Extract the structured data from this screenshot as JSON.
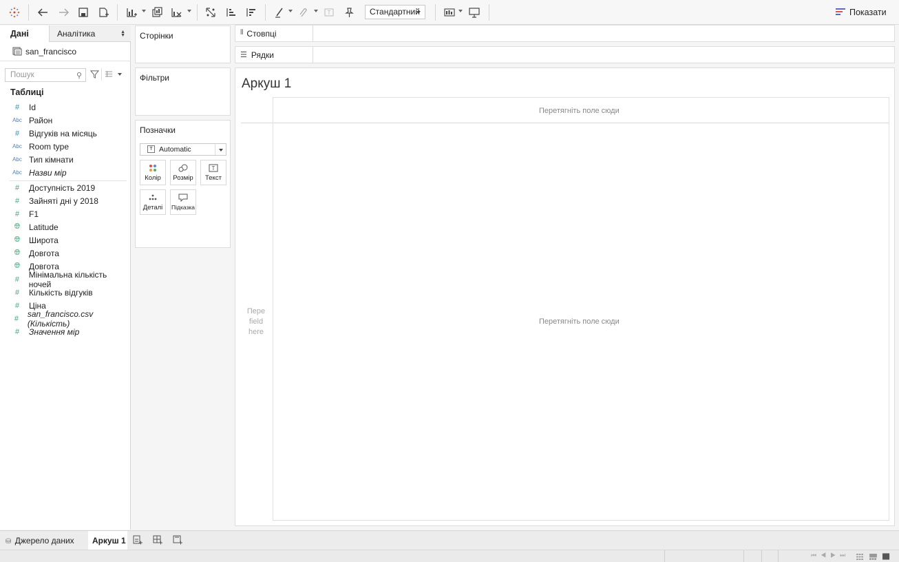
{
  "toolbar": {
    "view_mode_select": "Стандартний",
    "show_me_label": "Показати"
  },
  "data_pane": {
    "tab_data": "Дані",
    "tab_analytics": "Аналітика",
    "datasource": "san_francisco",
    "search_placeholder": "Пошук",
    "tables_header": "Таблиці",
    "dimensions": [
      {
        "icon": "#",
        "name": "Id",
        "italic": false
      },
      {
        "icon": "Abc",
        "name": "Район",
        "italic": false
      },
      {
        "icon": "#",
        "name": "Відгуків на місяць",
        "italic": false
      },
      {
        "icon": "Abc",
        "name": "Room type",
        "italic": false
      },
      {
        "icon": "Abc",
        "name": "Тип кімнати",
        "italic": false
      },
      {
        "icon": "Abc",
        "name": "Назви мір",
        "italic": true
      }
    ],
    "measures": [
      {
        "icon": "#",
        "name": "Доступність 2019",
        "italic": false
      },
      {
        "icon": "#",
        "name": "Зайняті дні у 2018",
        "italic": false
      },
      {
        "icon": "#",
        "name": "F1",
        "italic": false
      },
      {
        "icon": "globe",
        "name": "Latitude",
        "italic": false
      },
      {
        "icon": "globe",
        "name": "Широта",
        "italic": false
      },
      {
        "icon": "globe",
        "name": "Довгота",
        "italic": false
      },
      {
        "icon": "globe",
        "name": "Довгота",
        "italic": false
      },
      {
        "icon": "#",
        "name": "Мінімальна кількість ночей",
        "italic": false
      },
      {
        "icon": "#",
        "name": "Кількість відгуків",
        "italic": false
      },
      {
        "icon": "#",
        "name": "Ціна",
        "italic": false
      },
      {
        "icon": "#",
        "name": "san_francisco.csv (Кількість)",
        "italic": true
      },
      {
        "icon": "#",
        "name": "Значення мір",
        "italic": true
      }
    ]
  },
  "shelves": {
    "pages": "Сторінки",
    "filters": "Фільтри",
    "marks": "Позначки",
    "marks_type": "Automatic",
    "marks_buttons": [
      "Колір",
      "Розмір",
      "Текст",
      "Деталі",
      "Підказка"
    ],
    "columns": "Стовпці",
    "rows": "Рядки"
  },
  "view": {
    "sheet_title": "Аркуш 1",
    "drop_top": "Перетягніть поле сюди",
    "drop_center": "Перетягніть поле сюди",
    "drop_left_lines": [
      "Пере",
      "field",
      "here"
    ]
  },
  "bottom": {
    "datasource_tab": "Джерело даних",
    "sheet_tab": "Аркуш 1"
  },
  "colors": {
    "dimension_icon": "#5a7ea6",
    "measure_icon": "#4aa37a",
    "show_me_icon": "#5b6bb8"
  }
}
